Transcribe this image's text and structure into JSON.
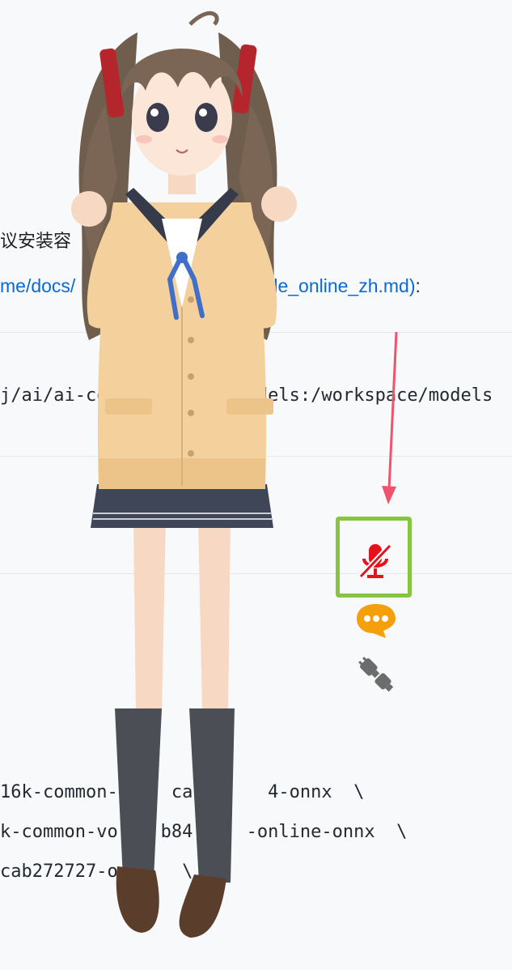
{
  "document": {
    "line_partial_1": "议安装容",
    "link_start": "me/docs/",
    "link_end": "le_online_zh.md)",
    "colon": ":",
    "code_line_1": "j/ai/ai-co              dels:/workspace/models",
    "code_line_2": "16k-common-     cab8     4-onnx  \\",
    "code_line_3": "k-common-vo    b84     -online-onnx  \\",
    "code_line_4": "cab272727-o      \\"
  },
  "controls": {
    "mic_state": "muted",
    "mic_icon": "mic-off-icon",
    "chat_icon": "chat-bubble-icon",
    "plug_icon": "plug-icon",
    "colors": {
      "mic": "#e8101a",
      "chat": "#f5a00b",
      "plug": "#6c6c6c",
      "highlight": "#86c540",
      "arrow": "#f0546c",
      "link": "#0969da"
    }
  }
}
